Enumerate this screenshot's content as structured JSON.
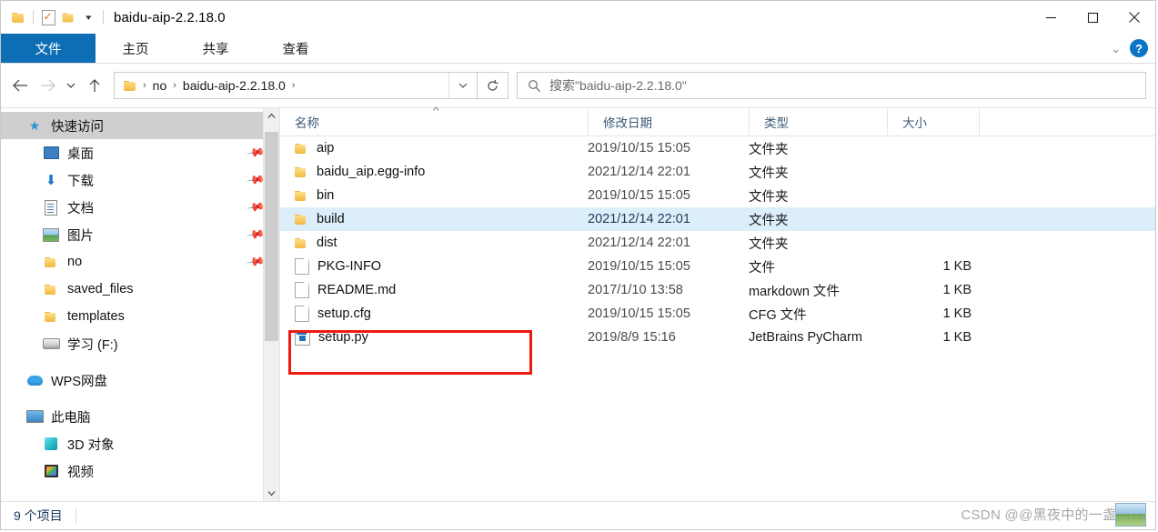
{
  "window": {
    "title": "baidu-aip-2.2.18.0",
    "quick_access": [
      {
        "name": "folder-icon",
        "label": ""
      },
      {
        "name": "properties-icon",
        "label": ""
      },
      {
        "name": "new-folder-icon",
        "label": ""
      },
      {
        "name": "customize-caret-icon",
        "label": "▾"
      }
    ],
    "controls": {
      "minimize": "—",
      "maximize": "▢",
      "close": "✕"
    }
  },
  "ribbon": {
    "tabs": [
      {
        "label": "文件",
        "active": true
      },
      {
        "label": "主页",
        "active": false
      },
      {
        "label": "共享",
        "active": false
      },
      {
        "label": "查看",
        "active": false
      }
    ],
    "expand_caret": "⌄",
    "help_label": "?"
  },
  "addressbar": {
    "back": "←",
    "forward": "→",
    "recent": "⌄",
    "up": "↑",
    "crumbs": [
      "no",
      "baidu-aip-2.2.18.0"
    ],
    "separator": "›",
    "dropdown": "⌄",
    "refresh": "↻"
  },
  "search": {
    "placeholder": "搜索\"baidu-aip-2.2.18.0\""
  },
  "sidebar": {
    "items": [
      {
        "label": "快速访问",
        "icon": "star-icon",
        "indent": 0,
        "pinned": false,
        "selected": true
      },
      {
        "label": "桌面",
        "icon": "desktop-icon",
        "indent": 1,
        "pinned": true,
        "selected": false
      },
      {
        "label": "下载",
        "icon": "download-icon",
        "indent": 1,
        "pinned": true,
        "selected": false
      },
      {
        "label": "文档",
        "icon": "documents-icon",
        "indent": 1,
        "pinned": true,
        "selected": false
      },
      {
        "label": "图片",
        "icon": "pictures-icon",
        "indent": 1,
        "pinned": true,
        "selected": false
      },
      {
        "label": "no",
        "icon": "folder-icon",
        "indent": 1,
        "pinned": true,
        "selected": false
      },
      {
        "label": "saved_files",
        "icon": "folder-icon",
        "indent": 1,
        "pinned": false,
        "selected": false
      },
      {
        "label": "templates",
        "icon": "folder-icon",
        "indent": 1,
        "pinned": false,
        "selected": false
      },
      {
        "label": "学习 (F:)",
        "icon": "drive-icon",
        "indent": 1,
        "pinned": false,
        "selected": false
      },
      {
        "label": "WPS网盘",
        "icon": "cloud-icon",
        "indent": 0,
        "pinned": false,
        "selected": false
      },
      {
        "label": "此电脑",
        "icon": "this-pc-icon",
        "indent": 0,
        "pinned": false,
        "selected": false
      },
      {
        "label": "3D 对象",
        "icon": "3d-objects-icon",
        "indent": 1,
        "pinned": false,
        "selected": false
      },
      {
        "label": "视频",
        "icon": "videos-icon",
        "indent": 1,
        "pinned": false,
        "selected": false
      }
    ],
    "pin_glyph": "📌"
  },
  "filelist": {
    "columns": [
      {
        "key": "name",
        "label": "名称",
        "sorted": "asc"
      },
      {
        "key": "date",
        "label": "修改日期",
        "sorted": ""
      },
      {
        "key": "type",
        "label": "类型",
        "sorted": ""
      },
      {
        "key": "size",
        "label": "大小",
        "sorted": ""
      }
    ],
    "sort_caret": "^",
    "rows": [
      {
        "name": "aip",
        "date": "2019/10/15 15:05",
        "type": "文件夹",
        "size": "",
        "icon": "folder-icon",
        "selected": false
      },
      {
        "name": "baidu_aip.egg-info",
        "date": "2021/12/14 22:01",
        "type": "文件夹",
        "size": "",
        "icon": "folder-icon",
        "selected": false
      },
      {
        "name": "bin",
        "date": "2019/10/15 15:05",
        "type": "文件夹",
        "size": "",
        "icon": "folder-icon",
        "selected": false
      },
      {
        "name": "build",
        "date": "2021/12/14 22:01",
        "type": "文件夹",
        "size": "",
        "icon": "folder-icon",
        "selected": true
      },
      {
        "name": "dist",
        "date": "2021/12/14 22:01",
        "type": "文件夹",
        "size": "",
        "icon": "folder-icon",
        "selected": false
      },
      {
        "name": "PKG-INFO",
        "date": "2019/10/15 15:05",
        "type": "文件",
        "size": "1 KB",
        "icon": "file-icon",
        "selected": false
      },
      {
        "name": "README.md",
        "date": "2017/1/10 13:58",
        "type": "markdown 文件",
        "size": "1 KB",
        "icon": "file-icon",
        "selected": false
      },
      {
        "name": "setup.cfg",
        "date": "2019/10/15 15:05",
        "type": "CFG 文件",
        "size": "1 KB",
        "icon": "file-icon",
        "selected": false
      },
      {
        "name": "setup.py",
        "date": "2019/8/9 15:16",
        "type": "JetBrains PyCharm",
        "size": "1 KB",
        "icon": "pycharm-py-icon",
        "selected": false
      }
    ]
  },
  "statusbar": {
    "item_count": "9 个项目"
  },
  "watermark": {
    "text": "CSDN @@黑夜中的一盏明灯"
  },
  "colors": {
    "accent": "#0d6db5",
    "selection": "#ddeefb",
    "annotation": "#ee1b11",
    "nav_selected": "#cfcfcf"
  }
}
